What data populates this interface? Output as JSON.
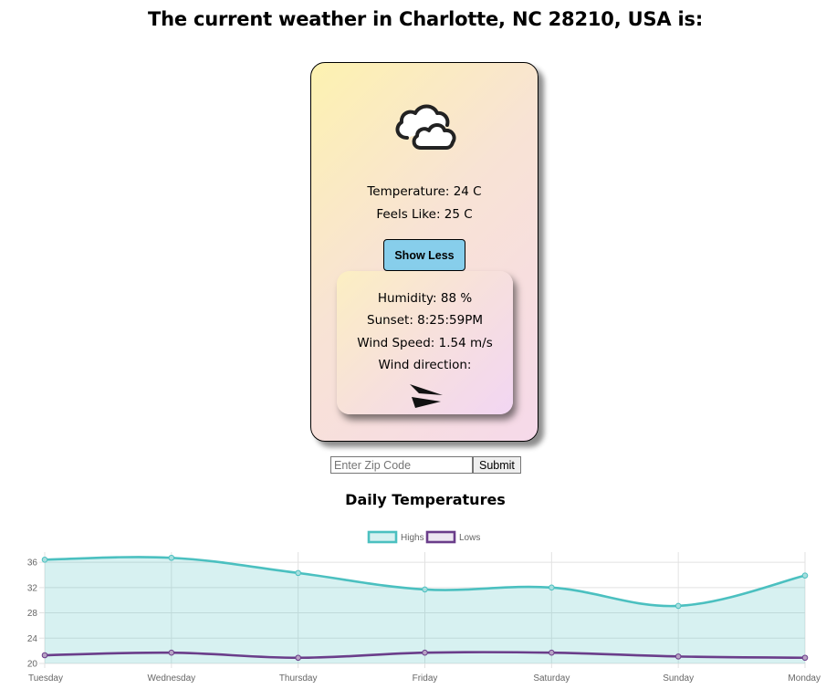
{
  "header": {
    "title": "The current weather in Charlotte, NC 28210, USA is:"
  },
  "weather_card": {
    "icon": "cloud-icon",
    "temperature": "Temperature: 24 C",
    "feels_like": "Feels Like: 25 C",
    "toggle_button_label": "Show Less",
    "details": {
      "humidity": "Humidity: 88 %",
      "sunset": "Sunset: 8:25:59PM",
      "wind_speed": "Wind Speed: 1.54 m/s",
      "wind_direction": "Wind direction:",
      "wind_icon": "wind-arrow-icon"
    }
  },
  "zip_form": {
    "placeholder": "Enter Zip Code",
    "value": "",
    "submit_label": "Submit"
  },
  "colors": {
    "highs": "#4bc0c0",
    "lows": "#6a3d8a",
    "button": "#87ceeb"
  },
  "chart_data": {
    "type": "line",
    "title": "Daily Temperatures",
    "categories": [
      "Tuesday",
      "Wednesday",
      "Thursday",
      "Friday",
      "Saturday",
      "Sunday",
      "Monday"
    ],
    "series": [
      {
        "name": "Highs",
        "values": [
          36.4,
          36.7,
          34.3,
          31.7,
          32.0,
          29.1,
          33.9
        ],
        "fill": true
      },
      {
        "name": "Lows",
        "values": [
          21.3,
          21.7,
          20.9,
          21.7,
          21.7,
          21.1,
          20.9
        ],
        "fill": false
      }
    ],
    "y_ticks": [
      20,
      24,
      28,
      32,
      36
    ],
    "ylim": [
      20,
      37.6
    ],
    "legend": "top-center",
    "grid": true
  }
}
